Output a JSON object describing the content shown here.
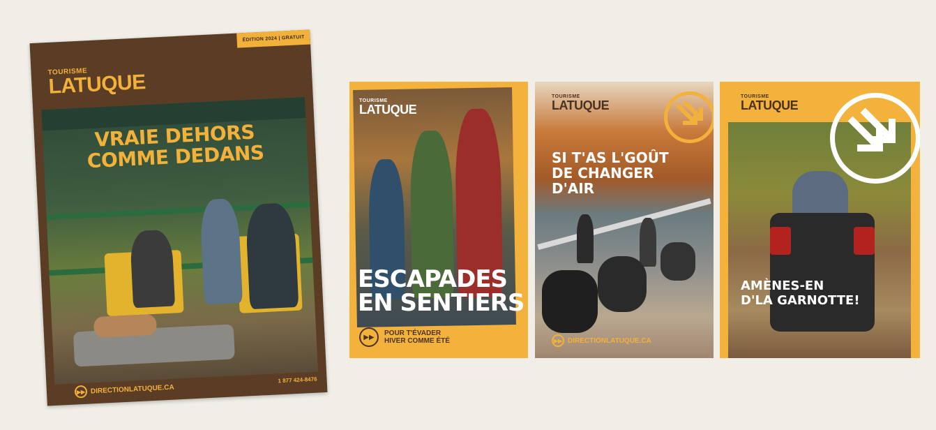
{
  "colors": {
    "background": "#f1eee8",
    "brown": "#5b3d25",
    "orange": "#f2b13a"
  },
  "brochure": {
    "edition": "ÉDITION 2024 | GRATUIT",
    "brand_small": "TOURISME",
    "brand_big": "LATUQUE",
    "headline_line1": "VRAIE DEHORS",
    "headline_line2": "COMME DEDANS",
    "url": "DIRECTIONLATUQUE.CA",
    "phone": "1 877 424-8476",
    "icon": "forward-arrows-icon"
  },
  "posters": [
    {
      "brand_small": "TOURISME",
      "brand_big": "LATUQUE",
      "headline_line1": "ESCAPADES",
      "headline_line2": "EN SENTIERS",
      "tagline_line1": "POUR T'ÉVADER",
      "tagline_line2": "HIVER COMME ÉTÉ",
      "icon": "forward-arrows-icon"
    },
    {
      "brand_small": "TOURISME",
      "brand_big": "LATUQUE",
      "headline_line1": "SI T'AS L'GOÛT",
      "headline_line2": "DE CHANGER",
      "headline_line3": "D'AIR",
      "url": "DIRECTIONLATUQUE.CA",
      "icon": "arrows-circle-icon"
    },
    {
      "brand_small": "TOURISME",
      "brand_big": "LATUQUE",
      "headline_line1": "AMÈNES-EN",
      "headline_line2": "D'LA GARNOTTE!",
      "icon": "arrows-circle-icon"
    }
  ]
}
